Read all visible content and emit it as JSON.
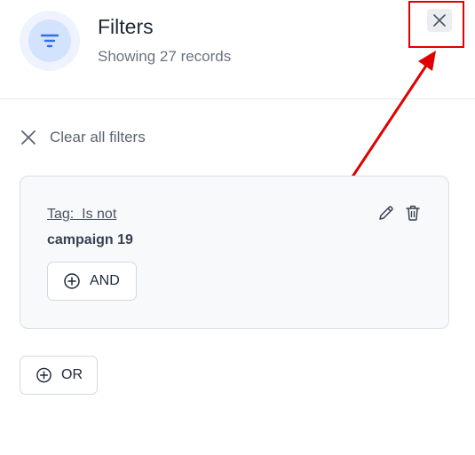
{
  "header": {
    "title": "Filters",
    "subtitle": "Showing 27 records",
    "icon": "filter-icon",
    "close_icon": "close-icon"
  },
  "clear_filters": {
    "label": "Clear all filters",
    "icon": "close-icon"
  },
  "filter_group": {
    "condition_field": "Tag:  Is not",
    "condition_value": "campaign 19",
    "edit_icon": "pencil-icon",
    "delete_icon": "trash-icon",
    "and_label": "AND"
  },
  "or_label": "OR",
  "colors": {
    "accent": "#2f6fed",
    "annotation": "#e00000",
    "text_primary": "#1f2937",
    "text_secondary": "#6b7280"
  }
}
